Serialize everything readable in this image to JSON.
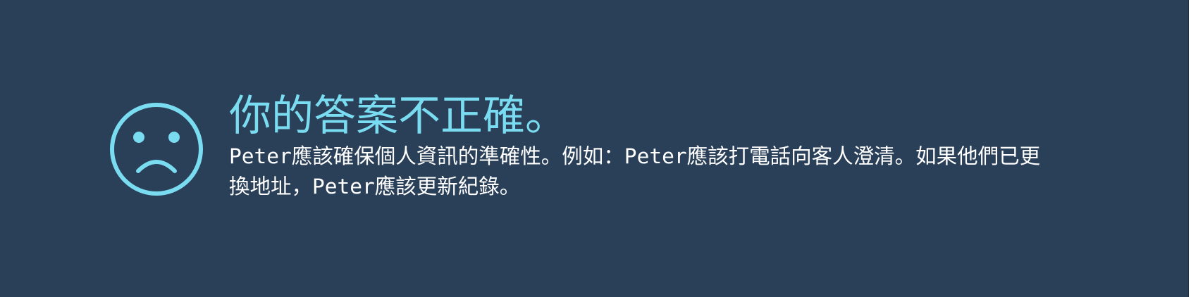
{
  "feedback": {
    "icon": "sad-face-icon",
    "title": "你的答案不正確。",
    "body": "Peter應該確保個人資訊的準確性。例如：Peter應該打電話向客人澄清。如果他們已更換地址，Peter應該更新紀錄。"
  },
  "colors": {
    "background": "#2a3f58",
    "accent": "#7adcf0",
    "text": "#ffffff"
  }
}
